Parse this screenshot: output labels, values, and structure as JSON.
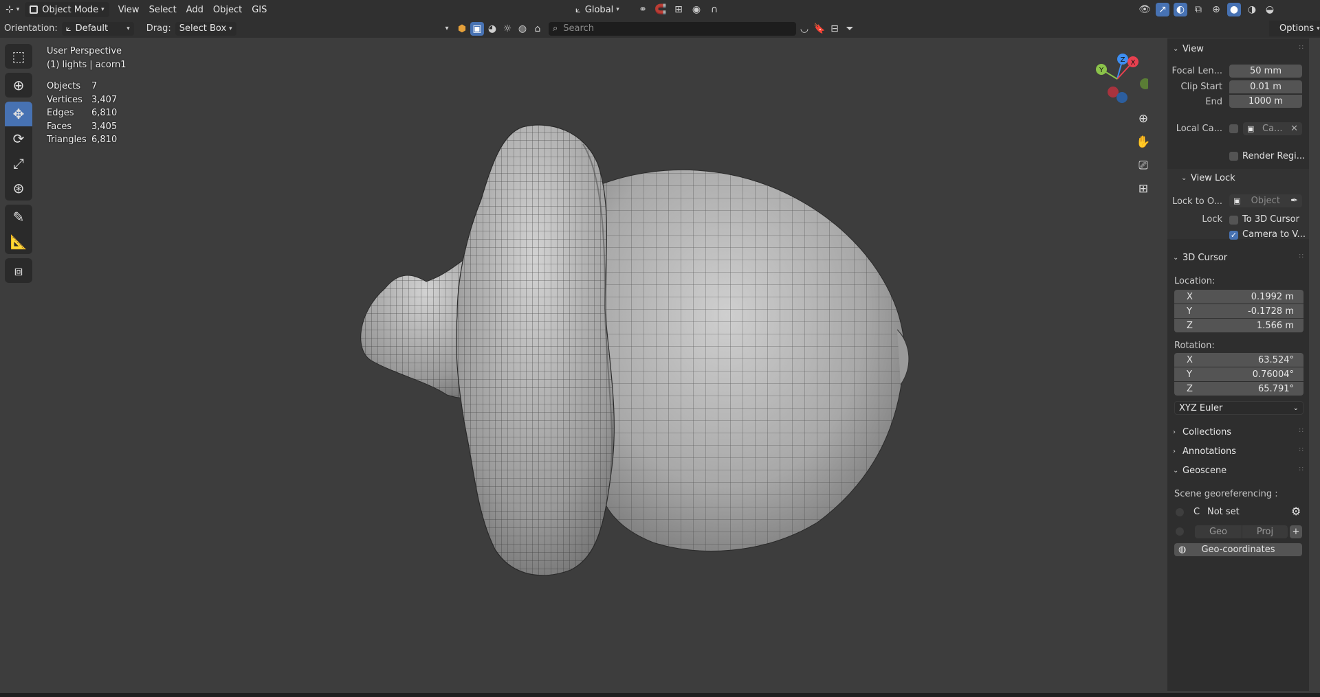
{
  "header": {
    "editor_icon": "editor-type-icon",
    "mode": "Object Mode",
    "menus": [
      "View",
      "Select",
      "Add",
      "Object",
      "GIS"
    ],
    "transform_orientation": "Global",
    "options_label": "Options"
  },
  "tool_header": {
    "orientation_label": "Orientation:",
    "orientation_value": "Default",
    "drag_label": "Drag:",
    "drag_value": "Select Box",
    "search_placeholder": "Search"
  },
  "viewport": {
    "perspective": "User Perspective",
    "context": "(1) lights | acorn1",
    "stats": [
      {
        "label": "Objects",
        "value": "7"
      },
      {
        "label": "Vertices",
        "value": "3,407"
      },
      {
        "label": "Edges",
        "value": "6,810"
      },
      {
        "label": "Faces",
        "value": "3,405"
      },
      {
        "label": "Triangles",
        "value": "6,810"
      }
    ],
    "gizmo": {
      "x": "X",
      "y": "Y",
      "z": "Z"
    }
  },
  "sidebar": {
    "view": {
      "title": "View",
      "focal_label": "Focal Len...",
      "focal_value": "50 mm",
      "clip_start_label": "Clip Start",
      "clip_start_value": "0.01 m",
      "end_label": "End",
      "end_value": "1000 m",
      "local_camera_label": "Local Ca...",
      "local_camera_value": "Ca...",
      "render_region_label": "Render Regi..."
    },
    "view_lock": {
      "title": "View Lock",
      "lock_to_object_label": "Lock to O...",
      "lock_to_object_placeholder": "Object",
      "lock_label": "Lock",
      "to_cursor_label": "To 3D Cursor",
      "camera_to_view_label": "Camera to V...",
      "camera_to_view_checked": true
    },
    "cursor": {
      "title": "3D Cursor",
      "location_label": "Location:",
      "location": [
        {
          "axis": "X",
          "value": "0.1992 m"
        },
        {
          "axis": "Y",
          "value": "-0.1728 m"
        },
        {
          "axis": "Z",
          "value": "1.566 m"
        }
      ],
      "rotation_label": "Rotation:",
      "rotation": [
        {
          "axis": "X",
          "value": "63.524°"
        },
        {
          "axis": "Y",
          "value": "0.76004°"
        },
        {
          "axis": "Z",
          "value": "65.791°"
        }
      ],
      "rotation_mode": "XYZ Euler"
    },
    "collections_title": "Collections",
    "annotations_title": "Annotations",
    "geoscene": {
      "title": "Geoscene",
      "georef_label": "Scene georeferencing :",
      "crs_prefix": "C",
      "crs_value": "Not set",
      "geo_label": "Geo",
      "proj_label": "Proj",
      "geo_coords_label": "Geo-coordinates"
    }
  },
  "colors": {
    "accent": "#4772b3",
    "axis_x": "#e8404f",
    "axis_y": "#8bc34a",
    "axis_z": "#3d8ef2"
  }
}
